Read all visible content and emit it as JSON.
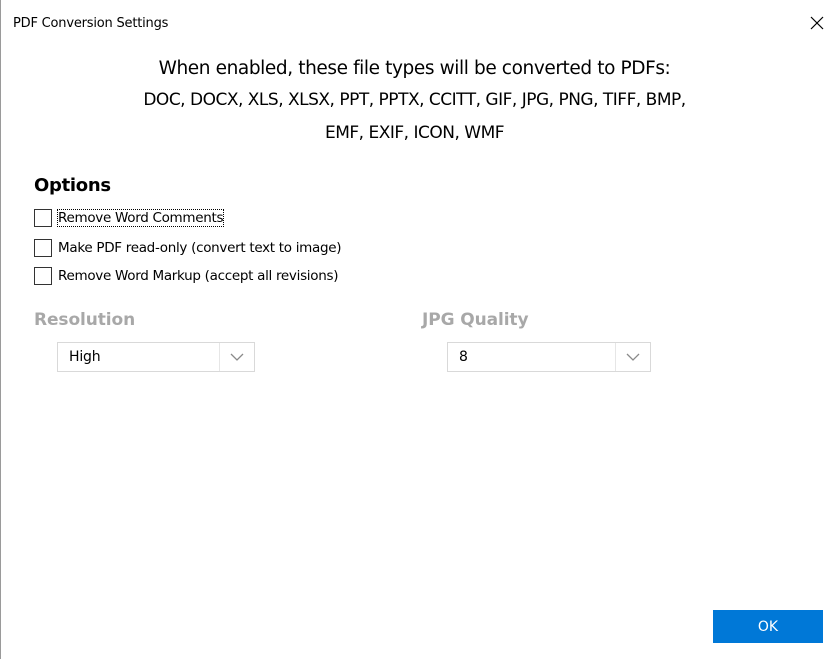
{
  "window": {
    "title": "PDF Conversion Settings",
    "close_icon": "close-icon"
  },
  "info": {
    "headline": "When enabled, these file types will be converted to PDFs:",
    "types_line1": "DOC, DOCX, XLS, XLSX, PPT, PPTX, CCITT, GIF, JPG, PNG, TIFF, BMP,",
    "types_line2": "EMF, EXIF, ICON, WMF"
  },
  "options": {
    "heading": "Options",
    "items": [
      {
        "label": "Remove Word Comments",
        "checked": false,
        "focused": true
      },
      {
        "label": "Make PDF read-only (convert text to image)",
        "checked": false,
        "focused": false
      },
      {
        "label": "Remove Word Markup (accept all revisions)",
        "checked": false,
        "focused": false
      }
    ]
  },
  "resolution": {
    "label": "Resolution",
    "value": "High",
    "icon": "chevron-down-icon"
  },
  "jpg_quality": {
    "label": "JPG Quality",
    "value": "8",
    "icon": "chevron-down-icon"
  },
  "footer": {
    "ok_label": "OK"
  },
  "colors": {
    "accent": "#0078d7",
    "disabled_label": "#a8a8a8"
  }
}
